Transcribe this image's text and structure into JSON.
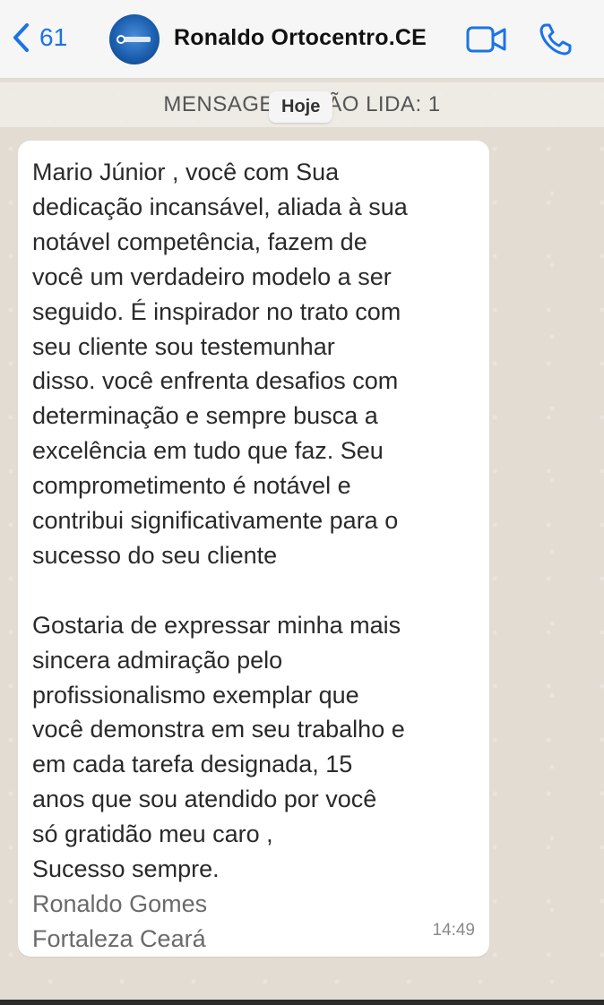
{
  "header": {
    "back_count": "61",
    "contact_name": "Ronaldo Ortocentro.CE"
  },
  "chat": {
    "unread_banner": "MENSAGENS NÃO LIDA: 1",
    "date_chip": "Hoje",
    "message": {
      "paragraph1": "Mario Júnior , você com Sua\ndedicação incansável, aliada à sua\nnotável competência, fazem de\nvocê um verdadeiro modelo a ser\nseguido. É inspirador no trato com\nseu cliente sou testemunhar\ndisso. você enfrenta desafios com\ndeterminação e sempre busca a\nexcelência em tudo que faz. Seu\ncomprometimento é notável e\ncontribui significativamente para o\nsucesso do seu cliente",
      "paragraph2": "Gostaria de expressar minha mais\nsincera admiração pelo\nprofissionalismo exemplar que\nvocê demonstra em seu trabalho e\nem cada tarefa designada, 15\nanos que  sou atendido por você\nsó gratidão meu caro ,\nSucesso sempre.",
      "signature": "Ronaldo Gomes\nFortaleza Ceará",
      "time": "14:49"
    }
  },
  "colors": {
    "accent": "#1a73e8",
    "bubble": "#ffffff",
    "wallpaper": "#e2dcd3"
  },
  "icons": [
    "chevron-left-icon",
    "video-call-icon",
    "phone-icon"
  ]
}
